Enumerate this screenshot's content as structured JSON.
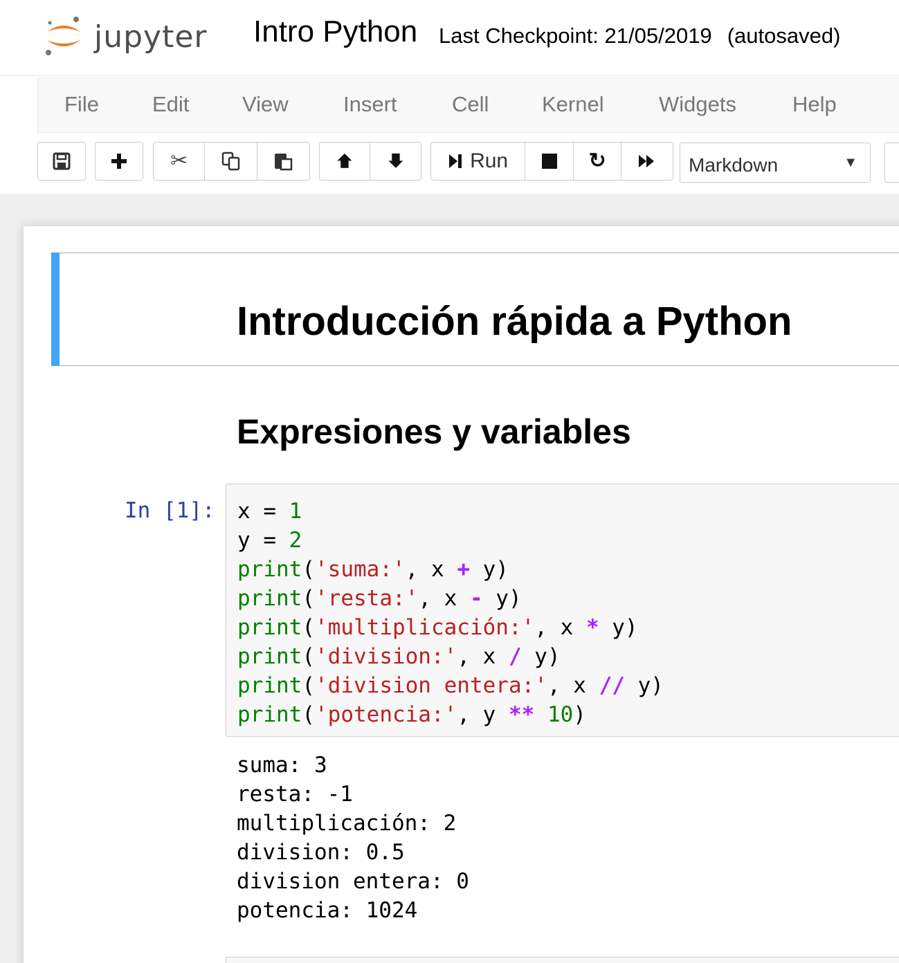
{
  "header": {
    "logo_text": "jupyter",
    "notebook_name": "Intro Python",
    "checkpoint": "Last Checkpoint: 21/05/2019",
    "autosave_status": "(autosaved)"
  },
  "menubar": {
    "items": [
      "File",
      "Edit",
      "View",
      "Insert",
      "Cell",
      "Kernel",
      "Widgets",
      "Help"
    ]
  },
  "toolbar": {
    "icons": {
      "save": "save-icon",
      "insert": "plus-icon",
      "cut": "scissors-icon",
      "copy": "copy-icon",
      "paste": "paste-icon",
      "move_up": "arrow-up-icon",
      "move_down": "arrow-down-icon",
      "run": "step-forward-icon",
      "interrupt": "stop-icon",
      "restart": "repeat-icon",
      "restart_run_all": "fast-forward-icon"
    },
    "run_label": "Run",
    "cell_type": "Markdown"
  },
  "notebook": {
    "title_heading": "Introducción rápida a Python",
    "section_heading": "Expresiones y variables",
    "cells": [
      {
        "prompt": "In [1]:",
        "source": [
          "x = 1",
          "y = 2",
          "print('suma:', x + y)",
          "print('resta:', x - y)",
          "print('multiplicación:', x * y)",
          "print('division:', x / y)",
          "print('division entera:', x // y)",
          "print('potencia:', y ** 10)"
        ],
        "output": [
          "suma: 3",
          "resta: -1",
          "multiplicación: 2",
          "division: 0.5",
          "division entera: 0",
          "potencia: 1024"
        ]
      }
    ]
  },
  "colors": {
    "selected_cell_bar": "#42a5f5",
    "prompt": "#303f9f",
    "keyword": "#008000",
    "string": "#ba2121",
    "operator": "#aa22ff",
    "logo_orange": "#f37726",
    "logo_grey": "#767677"
  }
}
